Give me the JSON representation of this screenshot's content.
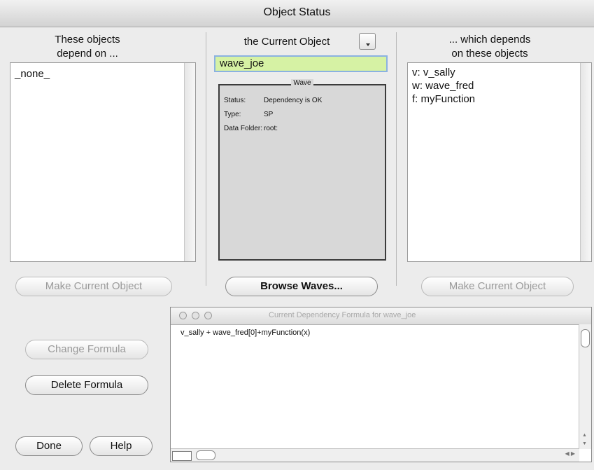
{
  "window": {
    "title": "Object Status"
  },
  "left": {
    "heading": "These objects\ndepend on ...",
    "items": [
      "_none_"
    ],
    "button": "Make Current Object"
  },
  "center": {
    "heading": "the Current Object",
    "current_object": "wave_joe",
    "panel_title": "Wave",
    "rows": [
      {
        "label": "Status:",
        "value": "Dependency is OK"
      },
      {
        "label": "Type:",
        "value": "SP"
      },
      {
        "label": "Data Folder:",
        "value": "root:"
      }
    ],
    "button": "Browse Waves..."
  },
  "right": {
    "heading": "... which depends\non these objects",
    "items": [
      "v: v_sally",
      "w: wave_fred",
      "f: myFunction"
    ],
    "button": "Make Current Object"
  },
  "actions": {
    "change_formula": "Change Formula",
    "delete_formula": "Delete Formula",
    "done": "Done",
    "help": "Help"
  },
  "formula_window": {
    "title": "Current Dependency Formula for wave_joe",
    "formula": "v_sally + wave_fred[0]+myFunction(x)"
  }
}
